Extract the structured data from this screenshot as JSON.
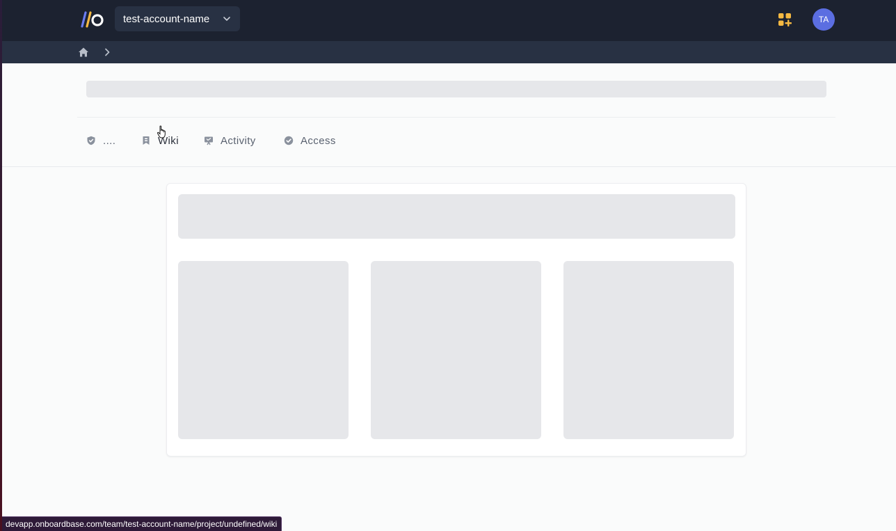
{
  "header": {
    "account_name": "test-account-name",
    "avatar_initials": "TA",
    "accent_color": "#5b6ee1",
    "apps_icon_color": "#f5b942"
  },
  "breadcrumb": {
    "icons": [
      "home-icon",
      "chevron-right-icon"
    ]
  },
  "tabs": [
    {
      "label": "....",
      "icon": "shield-icon"
    },
    {
      "label": "Wiki",
      "icon": "bookmark-icon"
    },
    {
      "label": "Activity",
      "icon": "presentation-icon"
    },
    {
      "label": "Access",
      "icon": "check-badge-icon"
    }
  ],
  "status_bar": {
    "url": "devapp.onboardbase.com/team/test-account-name/project/undefined/wiki"
  }
}
